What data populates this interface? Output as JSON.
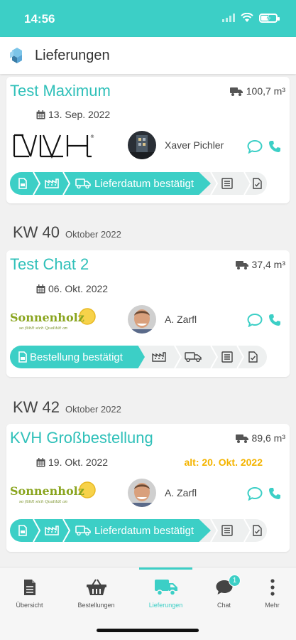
{
  "status": {
    "time": "14:56"
  },
  "header": {
    "title": "Lieferungen"
  },
  "orders": [
    {
      "title": "Test Maximum",
      "volume": "100,7 m³",
      "date": "13. Sep. 2022",
      "alt_date": "",
      "supplier_logo": "KVH",
      "contact": "Xaver Pichler",
      "status_label": "Lieferdatum bestätigt",
      "status_progress": "3 of 5"
    },
    {
      "title": "Test Chat 2",
      "volume": "37,4 m³",
      "date": "06. Okt. 2022",
      "alt_date": "",
      "supplier_logo": "Sonnenholz",
      "supplier_tagline": "so fühlt sich Qualität an",
      "contact": "A. Zarfl",
      "status_label": "Bestellung bestätigt",
      "status_progress": "1 of 5"
    },
    {
      "title": "KVH Großbestellung",
      "volume": "89,6 m³",
      "date": "19. Okt. 2022",
      "alt_date": "alt: 20. Okt. 2022",
      "supplier_logo": "Sonnenholz",
      "supplier_tagline": "so fühlt sich Qualität an",
      "contact": "A. Zarfl",
      "status_label": "Lieferdatum bestätigt",
      "status_progress": "3 of 5"
    }
  ],
  "weeks": [
    {
      "kw": "KW 40",
      "month": "Oktober 2022"
    },
    {
      "kw": "KW 42",
      "month": "Oktober 2022"
    }
  ],
  "tabs": [
    {
      "label": "Übersicht",
      "icon": "document-icon"
    },
    {
      "label": "Bestellungen",
      "icon": "basket-icon"
    },
    {
      "label": "Lieferungen",
      "icon": "truck-icon",
      "active": true
    },
    {
      "label": "Chat",
      "icon": "chat-icon",
      "badge": "1"
    },
    {
      "label": "Mehr",
      "icon": "more-icon"
    }
  ],
  "colors": {
    "accent": "#3ccfc6",
    "title": "#2fc0b9",
    "warning": "#f4b400"
  }
}
